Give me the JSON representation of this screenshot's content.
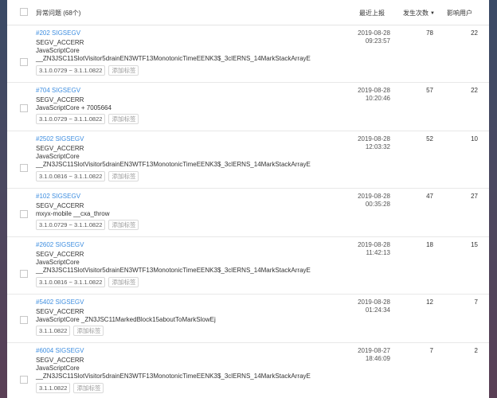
{
  "header": {
    "title": "异常问题 (68个)",
    "col_recent": "最近上报",
    "col_count": "发生次数",
    "col_users": "影响用户"
  },
  "rows": [
    {
      "title": "#202 SIGSEGV",
      "type": "SEGV_ACCERR",
      "l2": "JavaScriptCore",
      "l3": "__ZN3JSC11SlotVisitor5drainEN3WTF13MonotonicTimeEENK3$_3clERNS_14MarkStackArrayE",
      "version": "3.1.0.0729 ~ 3.1.1.0822",
      "add": "添加标签",
      "date": "2019-08-28",
      "time": "09:23:57",
      "count": "78",
      "users": "22"
    },
    {
      "title": "#704 SIGSEGV",
      "type": "SEGV_ACCERR",
      "l2": "JavaScriptCore + 7005664",
      "l3": "",
      "version": "3.1.0.0729 ~ 3.1.1.0822",
      "add": "添加标签",
      "date": "2019-08-28",
      "time": "10:20:46",
      "count": "57",
      "users": "22"
    },
    {
      "title": "#2502 SIGSEGV",
      "type": "SEGV_ACCERR",
      "l2": "JavaScriptCore",
      "l3": "__ZN3JSC11SlotVisitor5drainEN3WTF13MonotonicTimeEENK3$_3clERNS_14MarkStackArrayE",
      "version": "3.1.0.0816 ~ 3.1.1.0822",
      "add": "添加标签",
      "date": "2019-08-28",
      "time": "12:03:32",
      "count": "52",
      "users": "10"
    },
    {
      "title": "#102 SIGSEGV",
      "type": "SEGV_ACCERR",
      "l2": "mxyx-mobile __cxa_throw",
      "l3": "",
      "version": "3.1.0.0729 ~ 3.1.1.0822",
      "add": "添加标签",
      "date": "2019-08-28",
      "time": "00:35:28",
      "count": "47",
      "users": "27"
    },
    {
      "title": "#2602 SIGSEGV",
      "type": "SEGV_ACCERR",
      "l2": "JavaScriptCore",
      "l3": "__ZN3JSC11SlotVisitor5drainEN3WTF13MonotonicTimeEENK3$_3clERNS_14MarkStackArrayE",
      "version": "3.1.0.0816 ~ 3.1.1.0822",
      "add": "添加标签",
      "date": "2019-08-28",
      "time": "11:42:13",
      "count": "18",
      "users": "15"
    },
    {
      "title": "#5402 SIGSEGV",
      "type": "SEGV_ACCERR",
      "l2": "JavaScriptCore _ZN3JSC11MarkedBlock15aboutToMarkSlowEj",
      "l3": "",
      "version": "3.1.1.0822",
      "add": "添加标签",
      "date": "2019-08-28",
      "time": "01:24:34",
      "count": "12",
      "users": "7"
    },
    {
      "title": "#6004 SIGSEGV",
      "type": "SEGV_ACCERR",
      "l2": "JavaScriptCore",
      "l3": "__ZN3JSC11SlotVisitor5drainEN3WTF13MonotonicTimeEENK3$_3clERNS_14MarkStackArrayE",
      "version": "3.1.1.0822",
      "add": "添加标签",
      "date": "2019-08-27",
      "time": "18:46:09",
      "count": "7",
      "users": "2"
    }
  ]
}
